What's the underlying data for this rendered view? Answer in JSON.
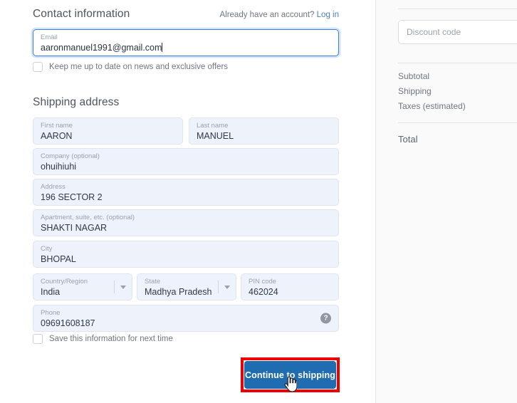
{
  "contact": {
    "title": "Contact information",
    "account_prompt": "Already have an account?",
    "login_link": "Log in",
    "email": {
      "label": "Email",
      "value": "aaronmanuel1991@gmail.com"
    },
    "newsletter_checkbox": "Keep me up to date on news and exclusive offers"
  },
  "shipping": {
    "title": "Shipping address",
    "fields": {
      "first_name": {
        "label": "First name",
        "value": "AARON"
      },
      "last_name": {
        "label": "Last name",
        "value": "MANUEL"
      },
      "company": {
        "label": "Company (optional)",
        "value": "ohuihiuhi"
      },
      "address": {
        "label": "Address",
        "value": "196 SECTOR 2"
      },
      "apartment": {
        "label": "Apartment, suite, etc. (optional)",
        "value": "SHAKTI NAGAR"
      },
      "city": {
        "label": "City",
        "value": "BHOPAL"
      },
      "country": {
        "label": "Country/Region",
        "value": "India"
      },
      "state": {
        "label": "State",
        "value": "Madhya Pradesh"
      },
      "pin_code": {
        "label": "PIN code",
        "value": "462024"
      },
      "phone": {
        "label": "Phone",
        "value": "09691608187"
      }
    },
    "save_checkbox": "Save this information for next time",
    "phone_help_icon": "help-circle-icon"
  },
  "actions": {
    "continue_label": "Continue to shipping"
  },
  "summary": {
    "discount_placeholder": "Discount code",
    "lines": [
      "Subtotal",
      "Shipping",
      "Taxes (estimated)"
    ],
    "total_label": "Total"
  },
  "colors": {
    "accent_blue": "#1f6cb0",
    "link_blue": "#4a7fc1",
    "annotation_red": "#ee0000",
    "field_fill": "#eef2fb"
  }
}
